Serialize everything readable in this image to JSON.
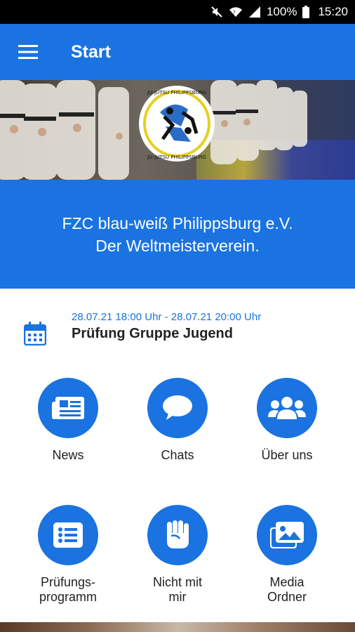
{
  "status_bar": {
    "battery": "100%",
    "time": "15:20",
    "icons": [
      "mute-icon",
      "wifi-icon",
      "signal-icon",
      "battery-icon"
    ]
  },
  "app_bar": {
    "title": "Start",
    "menu_icon": "menu-icon"
  },
  "hero": {
    "logo_text": "JU-JUTSU PHILIPPSBURG"
  },
  "banner": {
    "line1": "FZC blau-weiß Philippsburg e.V.",
    "line2": "Der Weltmeisterverein."
  },
  "event": {
    "date": "28.07.21 18:00 Uhr - 28.07.21 20:00 Uhr",
    "title": "Prüfung Gruppe Jugend",
    "icon": "calendar-icon"
  },
  "tiles": [
    {
      "label": "News",
      "icon": "newspaper-icon"
    },
    {
      "label": "Chats",
      "icon": "chat-bubble-icon"
    },
    {
      "label": "Über uns",
      "icon": "users-icon"
    },
    {
      "label_line1": "Prüfungs-",
      "label_line2": "programm",
      "icon": "list-icon"
    },
    {
      "label_line1": "Nicht mit",
      "label_line2": "mir",
      "icon": "fist-icon"
    },
    {
      "label_line1": "Media",
      "label_line2": "Ordner",
      "icon": "images-icon"
    }
  ],
  "colors": {
    "primary": "#1a73e0",
    "status_bar": "#000000",
    "text": "#222222"
  }
}
